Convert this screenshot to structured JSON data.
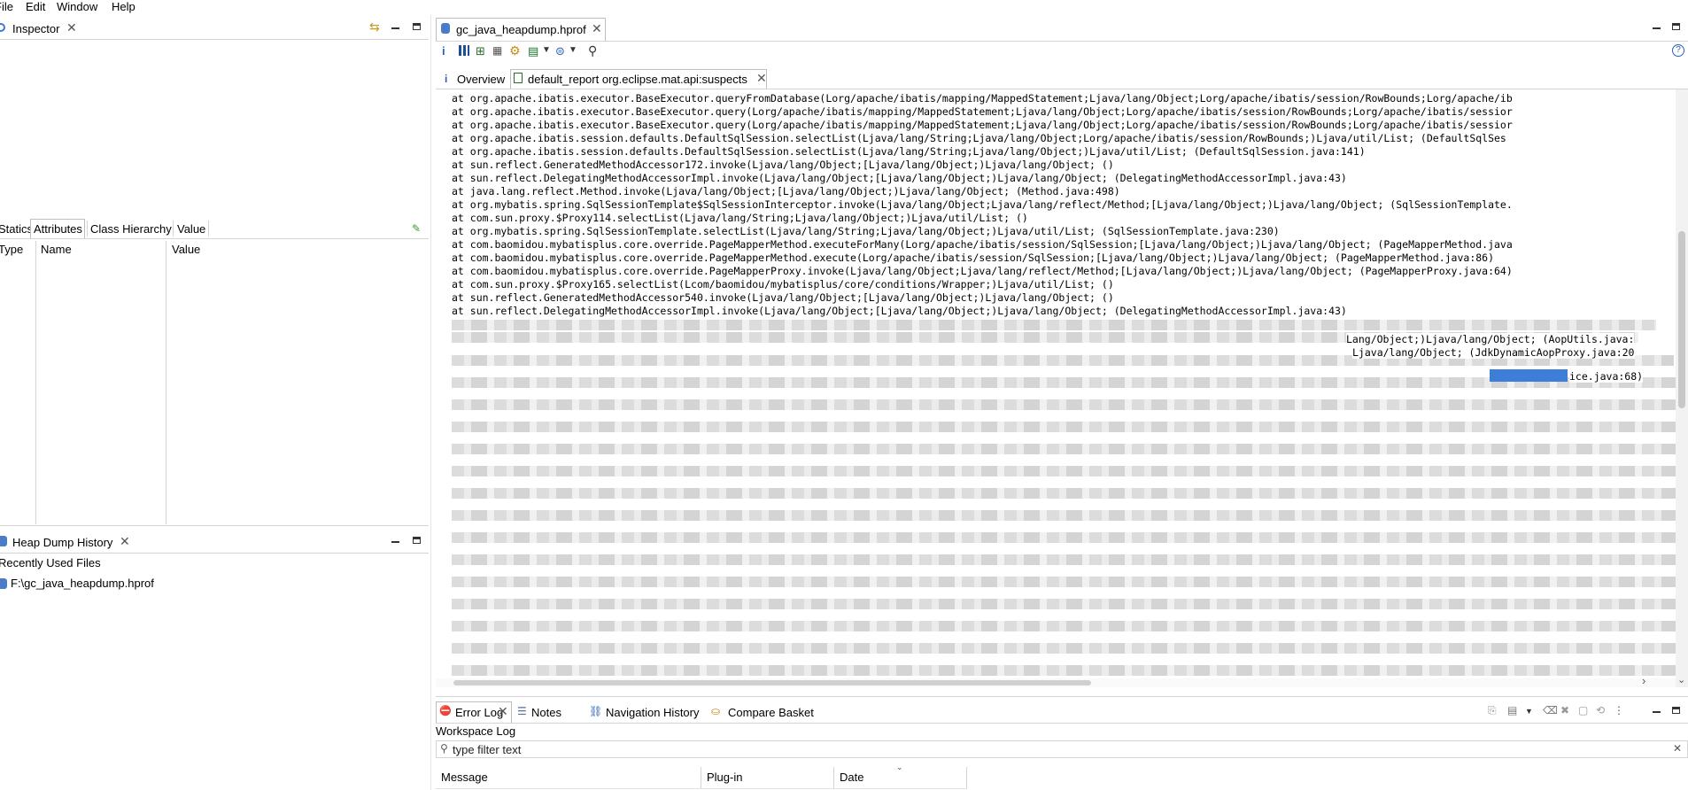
{
  "menu": [
    "File",
    "Edit",
    "Window",
    "Help"
  ],
  "left": {
    "inspector_title": "Inspector",
    "inspector_tabs": [
      "Statics",
      "Attributes",
      "Class Hierarchy",
      "Value"
    ],
    "inspector_columns": [
      "Type",
      "Name",
      "Value"
    ],
    "history_title": "Heap Dump History",
    "recent_label": "Recently Used Files",
    "recent_file": "F:\\gc_java_heapdump.hprof"
  },
  "editor": {
    "file_tab": "gc_java_heapdump.hprof",
    "subtabs": [
      "Overview",
      "default_report org.eclipse.mat.api:suspects"
    ],
    "trace_lines": [
      "at org.apache.ibatis.executor.BaseExecutor.queryFromDatabase(Lorg/apache/ibatis/mapping/MappedStatement;Ljava/lang/Object;Lorg/apache/ibatis/session/RowBounds;Lorg/apache/ib",
      "at org.apache.ibatis.executor.BaseExecutor.query(Lorg/apache/ibatis/mapping/MappedStatement;Ljava/lang/Object;Lorg/apache/ibatis/session/RowBounds;Lorg/apache/ibatis/sessior",
      "at org.apache.ibatis.executor.BaseExecutor.query(Lorg/apache/ibatis/mapping/MappedStatement;Ljava/lang/Object;Lorg/apache/ibatis/session/RowBounds;Lorg/apache/ibatis/sessior",
      "at org.apache.ibatis.session.defaults.DefaultSqlSession.selectList(Ljava/lang/String;Ljava/lang/Object;Lorg/apache/ibatis/session/RowBounds;)Ljava/util/List; (DefaultSqlSes",
      "at org.apache.ibatis.session.defaults.DefaultSqlSession.selectList(Ljava/lang/String;Ljava/lang/Object;)Ljava/util/List; (DefaultSqlSession.java:141)",
      "at sun.reflect.GeneratedMethodAccessor172.invoke(Ljava/lang/Object;[Ljava/lang/Object;)Ljava/lang/Object; ()",
      "at sun.reflect.DelegatingMethodAccessorImpl.invoke(Ljava/lang/Object;[Ljava/lang/Object;)Ljava/lang/Object; (DelegatingMethodAccessorImpl.java:43)",
      "at java.lang.reflect.Method.invoke(Ljava/lang/Object;[Ljava/lang/Object;)Ljava/lang/Object; (Method.java:498)",
      "at org.mybatis.spring.SqlSessionTemplate$SqlSessionInterceptor.invoke(Ljava/lang/Object;Ljava/lang/reflect/Method;[Ljava/lang/Object;)Ljava/lang/Object; (SqlSessionTemplate.",
      "at com.sun.proxy.$Proxy114.selectList(Ljava/lang/String;Ljava/lang/Object;)Ljava/util/List; ()",
      "at org.mybatis.spring.SqlSessionTemplate.selectList(Ljava/lang/String;Ljava/lang/Object;)Ljava/util/List; (SqlSessionTemplate.java:230)",
      "at com.baomidou.mybatisplus.core.override.PageMapperMethod.executeForMany(Lorg/apache/ibatis/session/SqlSession;[Ljava/lang/Object;)Ljava/lang/Object; (PageMapperMethod.java",
      "at com.baomidou.mybatisplus.core.override.PageMapperMethod.execute(Lorg/apache/ibatis/session/SqlSession;[Ljava/lang/Object;)Ljava/lang/Object; (PageMapperMethod.java:86)",
      "at com.baomidou.mybatisplus.core.override.PageMapperProxy.invoke(Ljava/lang/Object;Ljava/lang/reflect/Method;[Ljava/lang/Object;)Ljava/lang/Object; (PageMapperProxy.java:64)",
      "at com.sun.proxy.$Proxy165.selectList(Lcom/baomidou/mybatisplus/core/conditions/Wrapper;)Ljava/util/List; ()",
      "at sun.reflect.GeneratedMethodAccessor540.invoke(Ljava/lang/Object;[Ljava/lang/Object;)Ljava/lang/Object; ()",
      "at sun.reflect.DelegatingMethodAccessorImpl.invoke(Ljava/lang/Object;[Ljava/lang/Object;)Ljava/lang/Object; (DelegatingMethodAccessorImpl.java:43)"
    ],
    "partial_lines": [
      "Lang/Object;)Ljava/lang/Object; (AopUtils.java:",
      "Ljava/lang/Object; (JdkDynamicAopProxy.java:20",
      "ice.java:68)"
    ]
  },
  "bottom": {
    "tabs": [
      "Error Log",
      "Notes",
      "Navigation History",
      "Compare Basket"
    ],
    "workspace_log": "Workspace Log",
    "filter_placeholder": "type filter text",
    "columns": [
      "Message",
      "Plug-in",
      "Date"
    ]
  }
}
